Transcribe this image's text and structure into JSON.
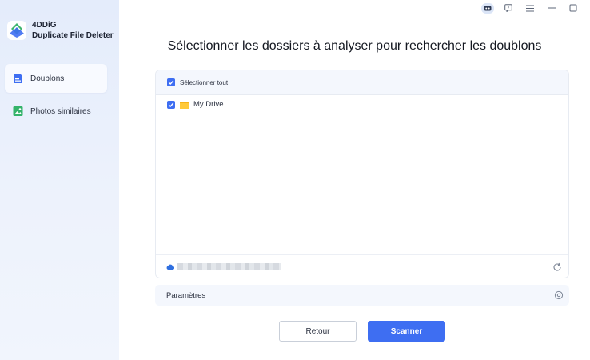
{
  "app": {
    "brand_line1": "4DDiG",
    "brand_line2": "Duplicate File Deleter",
    "accent_color": "#3e6ef2"
  },
  "sidebar": {
    "items": [
      {
        "label": "Doublons",
        "icon": "document-icon",
        "active": true
      },
      {
        "label": "Photos similaires",
        "icon": "image-icon",
        "active": false
      }
    ]
  },
  "titlebar": {
    "icons": [
      "robot-icon",
      "feedback-icon",
      "menu-icon",
      "minimize-icon",
      "maximize-icon"
    ]
  },
  "main": {
    "heading": "Sélectionner les dossiers à analyser pour rechercher les doublons",
    "select_all_label": "Sélectionner tout",
    "folders": [
      {
        "name": "My Drive",
        "checked": true
      }
    ],
    "settings_label": "Paramètres",
    "back_label": "Retour",
    "scan_label": "Scanner"
  }
}
